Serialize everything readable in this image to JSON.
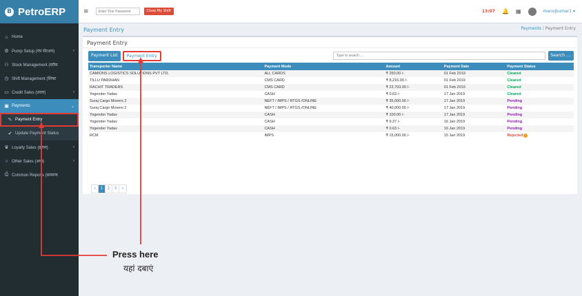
{
  "brand": {
    "name": "PetroERP",
    "logo_letter": "B"
  },
  "sidebar": {
    "items": [
      {
        "icon": "home-icon",
        "glyph": "⌂",
        "label": "Home",
        "chevron": ""
      },
      {
        "icon": "settings-icon",
        "glyph": "⚙",
        "label": "Pump Setup (पंप सेटअप)",
        "chevron": "‹"
      },
      {
        "icon": "stock-icon",
        "glyph": "⚇",
        "label": "Stock Management (स्टॉक",
        "chevron": ""
      },
      {
        "icon": "clock-icon",
        "glyph": "◷",
        "label": "Shift Management (शिफ्ट",
        "chevron": ""
      },
      {
        "icon": "credit-card-icon",
        "glyph": "▭",
        "label": "Credit Sales (उधार)",
        "chevron": "‹"
      },
      {
        "icon": "payments-icon",
        "glyph": "▣",
        "label": "Payments",
        "chevron": "⌄"
      },
      {
        "icon": "edit-icon",
        "glyph": "✎",
        "label": "Payment Entry",
        "chevron": ""
      },
      {
        "icon": "check-icon",
        "glyph": "✔",
        "label": "Update Payment Status",
        "chevron": ""
      },
      {
        "icon": "trophy-icon",
        "glyph": "♛",
        "label": "Loyalty Sales (इनाम)",
        "chevron": "‹"
      },
      {
        "icon": "circle-icon",
        "glyph": "○",
        "label": "Other Sales (अन्य)",
        "chevron": "‹"
      },
      {
        "icon": "print-icon",
        "glyph": "⎙",
        "label": "Common Reports (सामान्य",
        "chevron": ""
      }
    ]
  },
  "topbar": {
    "password_placeholder": "Enter Your Password",
    "close_shift_label": "Close My Shift",
    "clock": "13:07",
    "user_name": "manojkumar1 ▾"
  },
  "page": {
    "title": "Payment Entry",
    "breadcrumb_parent": "Payments",
    "breadcrumb_current": "Payment Entry",
    "box_title": "Payment Entry"
  },
  "tabs": {
    "list_label": "Payment List",
    "entry_label": "Payment Entry"
  },
  "search": {
    "placeholder": "Type to search ....",
    "button_label": "Search ...."
  },
  "table": {
    "headers": [
      "Transporter Name",
      "Payment Mode",
      "Amount",
      "Payment Date",
      "Payment Status"
    ],
    "rows": [
      [
        "CAMIONS LOGISTICS SOLUTIONS PVT LTD.",
        "ALL CARDS",
        "₹ 250.00 /-",
        "01 Feb 2019",
        "Cleared"
      ],
      [
        "TILLU PARDHAN",
        "CMS CARD",
        "₹ 8,216.00 /-",
        "01 Feb 2019",
        "Cleared"
      ],
      [
        "RACHIT TRADERS",
        "CMS CARD",
        "₹ 23,703.00 /-",
        "01 Feb 2019",
        "Cleared"
      ],
      [
        "Yogender Yadav",
        "CASH",
        "₹ 0.63 /-",
        "17 Jan 2019",
        "Cleared"
      ],
      [
        "Suraj Cargo Movers 2",
        "NEFT / IMPS / RTGS /ONLINE",
        "₹ 35,000.00 /-",
        "17 Jan 2019",
        "Pending"
      ],
      [
        "Suraj Cargo Movers 2",
        "NEFT / IMPS / RTGS /ONLINE",
        "₹ 40,000.00 /-",
        "17 Jan 2019",
        "Pending"
      ],
      [
        "Yogender Yadav",
        "CASH",
        "₹ 100.00 /-",
        "17 Jan 2019",
        "Pending"
      ],
      [
        "Yogender Yadav",
        "CASH",
        "₹ 9.37 /-",
        "16 Jan 2019",
        "Pending"
      ],
      [
        "Yogender Yadav",
        "CASH",
        "₹ 0.63 /-",
        "16 Jan 2019",
        "Pending"
      ],
      [
        "RCM",
        "IMPS",
        "₹ 15,000.00 /-",
        "15 Jan 2019",
        "Rejected"
      ]
    ]
  },
  "pager": [
    "«",
    "1",
    "2",
    "3",
    "»"
  ],
  "annotation": {
    "english": "Press here",
    "hindi": "यहां दबाएं"
  },
  "colors": {
    "accent": "#3c8dbc",
    "sidebar": "#222d32",
    "highlight": "#e53935"
  }
}
